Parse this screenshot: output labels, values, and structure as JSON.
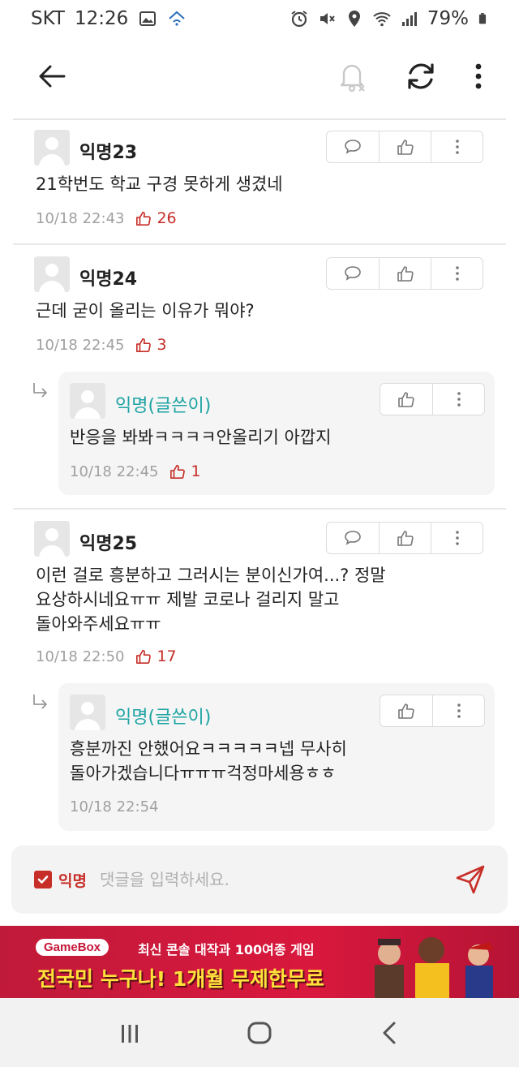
{
  "status_bar": {
    "carrier": "SKT",
    "time": "12:26",
    "battery": "79%",
    "icons": [
      "image-icon",
      "home-wifi-icon",
      "alarm-icon",
      "mute-icon",
      "location-icon",
      "wifi-icon",
      "signal-icon",
      "battery-icon"
    ]
  },
  "header": {
    "back_icon": "back-arrow-icon",
    "bell_icon": "bell-off-icon",
    "refresh_icon": "refresh-icon",
    "more_icon": "more-vertical-icon"
  },
  "comments": [
    {
      "author": "익명23",
      "body": "21학번도 학교 구경 못하게 생겼네",
      "timestamp": "10/18 22:43",
      "likes": "26",
      "actions": [
        "comment-icon",
        "thumbs-up-icon",
        "more-icon"
      ]
    },
    {
      "author": "익명24",
      "body": "근데 굳이 올리는 이유가 뭐야?",
      "timestamp": "10/18 22:45",
      "likes": "3",
      "actions": [
        "comment-icon",
        "thumbs-up-icon",
        "more-icon"
      ],
      "reply": {
        "author": "익명(글쓴이)",
        "body": "반응을 봐봐ㅋㅋㅋㅋ안올리기 아깝지",
        "timestamp": "10/18 22:45",
        "likes": "1"
      }
    },
    {
      "author": "익명25",
      "body_lines": [
        "이런 걸로 흥분하고 그러시는 분이신가여...? 정말",
        "요상하시네요ㅠㅠ 제발 코로나 걸리지 말고",
        "돌아와주세요ㅠㅠ"
      ],
      "timestamp": "10/18 22:50",
      "likes": "17",
      "actions": [
        "comment-icon",
        "thumbs-up-icon",
        "more-icon"
      ],
      "reply": {
        "author": "익명(글쓴이)",
        "body_lines": [
          "흥분까진 안했어요ㅋㅋㅋㅋㅋ넵 무사히",
          "돌아가겠습니다ㅠㅠㅠ걱정마세용ㅎㅎ"
        ],
        "timestamp": "10/18 22:54"
      }
    }
  ],
  "input_bar": {
    "anon_label": "익명",
    "anon_checked": true,
    "placeholder": "댓글을 입력하세요.",
    "send_icon": "send-icon"
  },
  "ad": {
    "logo": "GameBox",
    "line1": "최신 콘솔 대작과 100여종 게임",
    "line2_a": "전국민 누구나!",
    "line2_b": "1개월 무제한무료"
  },
  "nav": {
    "icons": [
      "recent-apps-icon",
      "home-icon",
      "back-icon"
    ]
  },
  "colors": {
    "accent_red": "#c72e28",
    "writer_teal": "#1ea3a3",
    "ad_red": "#d9183d"
  }
}
